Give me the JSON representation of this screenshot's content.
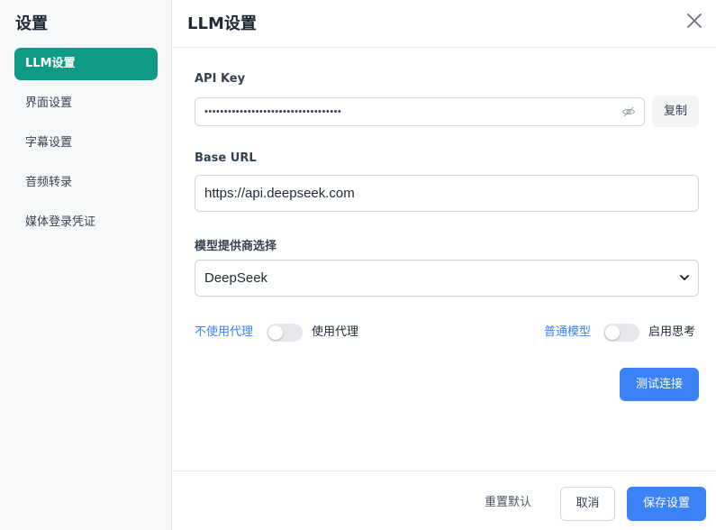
{
  "sidebar": {
    "title": "设置",
    "items": [
      {
        "label": "LLM设置",
        "active": true
      },
      {
        "label": "界面设置"
      },
      {
        "label": "字幕设置"
      },
      {
        "label": "音频转录"
      },
      {
        "label": "媒体登录凭证"
      }
    ]
  },
  "header": {
    "title": "LLM设置",
    "close_icon": "close-icon"
  },
  "form": {
    "api_key": {
      "label": "API Key",
      "value": "•••••••••••••••••••••••••••••••••••",
      "visibility_icon": "eye-off-icon",
      "copy_label": "复制"
    },
    "base_url": {
      "label": "Base URL",
      "value": "https://api.deepseek.com"
    },
    "provider": {
      "label": "模型提供商选择",
      "value": "DeepSeek"
    },
    "proxy_toggle": {
      "left_label": "不使用代理",
      "right_label": "使用代理",
      "on": false
    },
    "thinking_toggle": {
      "left_label": "普通模型",
      "right_label": "启用思考",
      "on": false
    },
    "test_label": "测试连接"
  },
  "footer": {
    "reset_label": "重置默认",
    "cancel_label": "取消",
    "save_label": "保存设置"
  },
  "colors": {
    "accent": "#0f9a85",
    "primary": "#3b82f6"
  }
}
